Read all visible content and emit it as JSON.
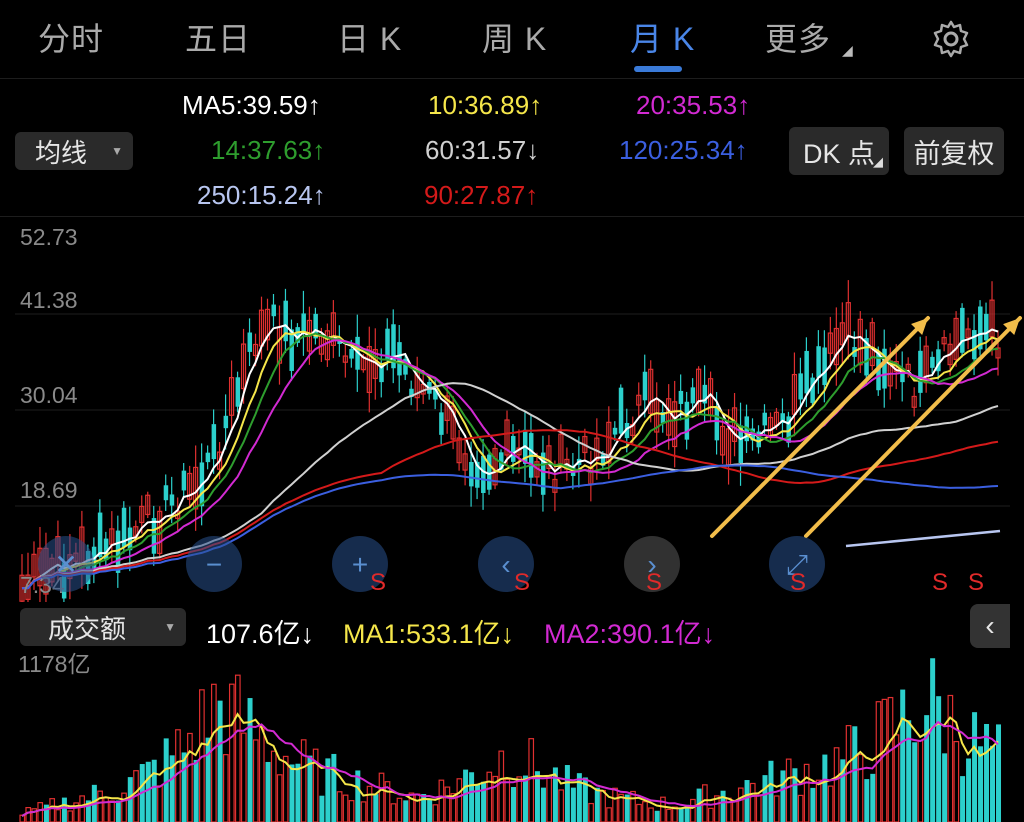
{
  "tabs": [
    {
      "label": "分时"
    },
    {
      "label": "五日"
    },
    {
      "label": "日 K"
    },
    {
      "label": "周 K"
    },
    {
      "label": "月 K"
    },
    {
      "label": "更多"
    }
  ],
  "active_tab": "月 K",
  "ma_panel": {
    "selector_label": "均线",
    "dk_button": "DK 点",
    "adjust_button": "前复权",
    "lines": [
      {
        "text": "MA5:39.59↑",
        "color": "#ffffff"
      },
      {
        "text": "10:36.89↑",
        "color": "#f5e64a"
      },
      {
        "text": "20:35.53↑",
        "color": "#d22ad2"
      },
      {
        "text": "14:37.63↑",
        "color": "#2e9e2e"
      },
      {
        "text": "60:31.57↓",
        "color": "#d0d0d0"
      },
      {
        "text": "120:25.34↑",
        "color": "#3b5fe0"
      },
      {
        "text": "250:15.24↑",
        "color": "#b8c6f0"
      },
      {
        "text": "90:27.87↑",
        "color": "#d41a1a"
      }
    ]
  },
  "price_axis": [
    "52.73",
    "41.38",
    "30.04",
    "18.69",
    "7.34"
  ],
  "chart_controls": [
    "zoom-out",
    "zoom-in",
    "scroll-left",
    "scroll-right",
    "fullscreen"
  ],
  "signal_marks": [
    "S",
    "S",
    "S",
    "S",
    "S",
    "S"
  ],
  "volume_panel": {
    "selector_label": "成交额",
    "current": "107.6亿↓",
    "ma1": "MA1:533.1亿↓",
    "ma2": "MA2:390.1亿↓",
    "axis_max": "1178亿",
    "collapse_icon": "chevron-left-icon"
  },
  "colors": {
    "up": "#e03030",
    "down": "#2cd0cc",
    "accent": "#3a7ad8",
    "arrow": "#f2bd4a"
  }
}
